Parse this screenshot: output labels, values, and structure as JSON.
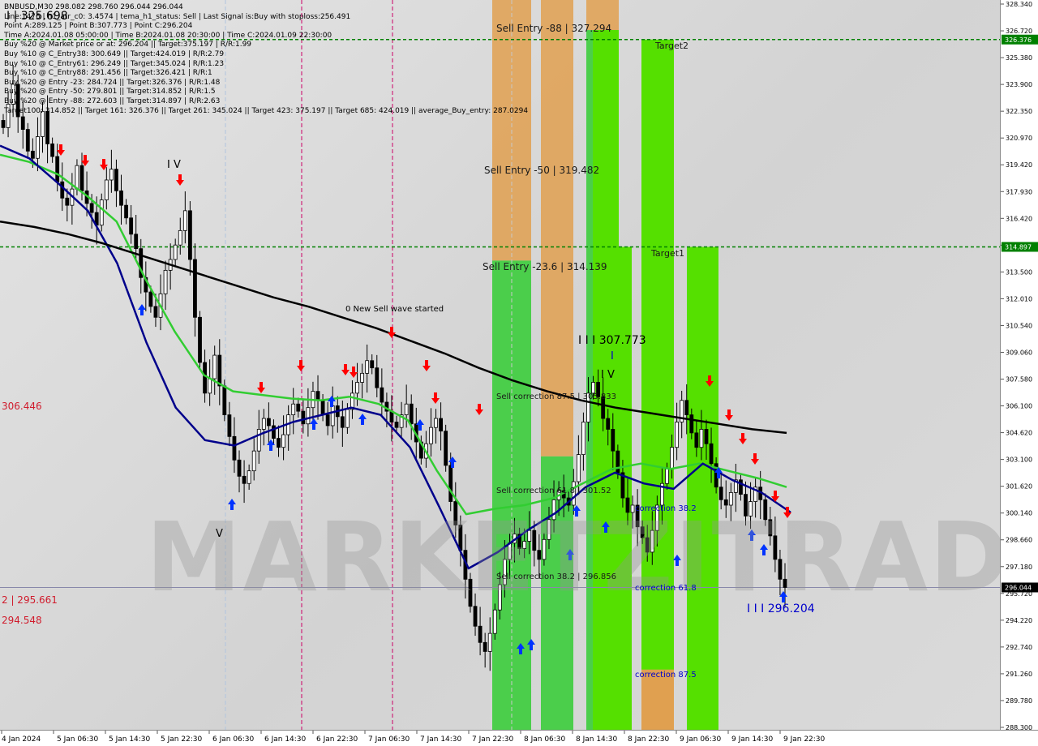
{
  "info_lines": [
    "BNBUSD,M30  298.082 298.760 296.044 296.044",
    "Line:1476 | h1_atr_c0: 3.4574 | tema_h1_status: Sell | Last Signal is:Buy with stoploss:256.491",
    "Point A:289.125 | Point B:307.773 | Point C:296.204",
    "Time A:2024.01.08 05:00:00 | Time B:2024.01.08 20:30:00 | Time C:2024.01.09 22:30:00",
    "Buy %20 @ Market price or at: 296.204 || Target:375.197 | R/R:1.99",
    "Buy %10 @ C_Entry38: 300.649 || Target:424.019 | R/R:2.79",
    "Buy %10 @ C_Entry61: 296.249 || Target:345.024 | R/R:1.23",
    "Buy %10 @ C_Entry88: 291.456 || Target:326.421 | R/R:1",
    "Buy %20 @ Entry -23: 284.724 || Target:326.376 | R/R:1.48",
    "Buy %20 @ Entry -50: 279.801 || Target:314.852 | R/R:1.5",
    "Buy %20 @ Entry -88: 272.603 || Target:314.897 | R/R:2.63",
    "Target100: 314.852 || Target 161: 326.376 || Target 261: 345.024 || Target 423: 375.197 || Target 685: 424.019 || average_Buy_entry: 287.0294"
  ],
  "chart_title": "BNBUSD,M30",
  "watermark": "MARKETZITRADE",
  "labels": {
    "wave_high": "I | 325.698",
    "wave_iv_top": "I V",
    "wave_v_bottom": "V",
    "new_sell_wave": "0 New Sell wave started",
    "point_b": "I I I 307.773",
    "point_b_tick": "I",
    "wave_iv_right": "I V",
    "point_c": "I I I 296.204",
    "sell_entry_88": "Sell Entry -88 | 327.294",
    "sell_entry_50": "Sell Entry -50 | 319.482",
    "sell_entry_23": "Sell Entry -23.6 | 314.139",
    "sell_corr_875": "Sell correction 87.5 | 305.833",
    "sell_corr_618": "Sell correction 61.8 | 301.52",
    "sell_corr_382": "Sell correction 38.2 | 296.856",
    "target2": "Target2",
    "target1": "Target1",
    "correction_382": "correction 38.2",
    "correction_618": "correction 61.8",
    "correction_875": "correction 87.5",
    "red_top": "306.446",
    "red_mid": "2 | 295.661",
    "red_low": "294.548"
  },
  "colors": {
    "background": "#dcdcdc",
    "zone_orange": "#e0a050",
    "zone_green": "#32cd32",
    "target_green": "#55e000",
    "ma_black": "#000000",
    "ma_navy": "#00008b",
    "ma_green": "#32cd32",
    "arrow_up": "#0033ff",
    "arrow_down": "#ff0000",
    "level_line": "#008000",
    "vline_red": "#cc0066",
    "label_red": "#d01b2c",
    "label_blue": "#0000cc"
  },
  "chart_data": {
    "type": "candlestick",
    "symbol": "BNBUSD",
    "timeframe": "M30",
    "ohlc_last": {
      "open": 298.082,
      "high": 298.76,
      "low": 296.044,
      "close": 296.044
    },
    "ylim": [
      288.3,
      328.34
    ],
    "y_ticks": [
      "328.340",
      "326.720",
      "325.380",
      "323.900",
      "322.350",
      "320.970",
      "319.420",
      "317.930",
      "316.420",
      "314.897",
      "313.500",
      "312.010",
      "310.540",
      "309.060",
      "307.580",
      "306.100",
      "304.620",
      "303.100",
      "301.620",
      "300.140",
      "298.660",
      "297.180",
      "295.720",
      "294.220",
      "292.740",
      "291.260",
      "289.780",
      "288.300"
    ],
    "x_ticks": [
      "4 Jan 2024",
      "5 Jan 06:30",
      "5 Jan 14:30",
      "5 Jan 22:30",
      "6 Jan 06:30",
      "6 Jan 14:30",
      "6 Jan 22:30",
      "7 Jan 06:30",
      "7 Jan 14:30",
      "7 Jan 22:30",
      "8 Jan 06:30",
      "8 Jan 14:30",
      "8 Jan 22:30",
      "9 Jan 06:30",
      "9 Jan 14:30",
      "9 Jan 22:30"
    ],
    "current_price": 296.044,
    "current_price_label": "296.044",
    "levels": [
      {
        "name": "target_161",
        "value": 326.376,
        "label": "326.376"
      },
      {
        "name": "target_100",
        "value": 314.897,
        "label": "314.897"
      }
    ],
    "close_series": [
      321.5,
      322.8,
      323.9,
      322.1,
      321.4,
      320.2,
      319.8,
      321.0,
      322.4,
      320.6,
      319.9,
      318.5,
      317.6,
      317.2,
      318.1,
      319.4,
      318.0,
      317.3,
      316.8,
      316.1,
      317.5,
      318.6,
      319.2,
      318.0,
      317.2,
      316.5,
      315.6,
      314.8,
      313.2,
      312.4,
      311.6,
      311.0,
      312.3,
      313.6,
      314.2,
      315.0,
      315.8,
      316.9,
      314.2,
      311.0,
      308.5,
      306.8,
      307.6,
      308.9,
      307.2,
      305.6,
      304.4,
      303.1,
      302.2,
      301.8,
      302.5,
      303.6,
      304.8,
      305.4,
      305.0,
      304.3,
      303.8,
      304.5,
      305.6,
      306.2,
      305.8,
      305.1,
      306.0,
      306.9,
      306.4,
      305.6,
      305.0,
      306.1,
      305.5,
      304.9,
      305.9,
      306.8,
      307.4,
      307.9,
      308.6,
      308.2,
      307.1,
      306.3,
      305.8,
      305.2,
      304.9,
      305.6,
      306.2,
      305.1,
      304.1,
      303.2,
      304.0,
      304.9,
      305.4,
      304.7,
      302.8,
      300.8,
      299.5,
      298.1,
      296.5,
      295.0,
      293.9,
      293.0,
      292.5,
      293.5,
      294.8,
      296.2,
      297.6,
      298.5,
      299.0,
      298.2,
      298.6,
      299.2,
      298.1,
      297.6,
      298.7,
      299.8,
      300.9,
      301.4,
      301.0,
      300.6,
      301.9,
      303.4,
      305.2,
      306.8,
      307.4,
      306.6,
      305.4,
      304.8,
      303.6,
      302.4,
      301.0,
      300.2,
      300.6,
      299.4,
      298.8,
      298.0,
      299.2,
      300.6,
      301.8,
      302.6,
      303.8,
      305.2,
      306.4,
      305.6,
      304.6,
      303.8,
      304.8,
      304.0,
      302.9,
      301.6,
      300.9,
      300.6,
      301.3,
      302.0,
      301.2,
      300.0,
      300.8,
      301.6,
      300.9,
      299.8,
      298.9,
      297.6,
      296.5,
      296.044
    ],
    "ma_black": [
      316.3,
      316.0,
      315.6,
      315.1,
      314.5,
      313.9,
      313.3,
      312.7,
      312.1,
      311.6,
      311.0,
      310.4,
      309.7,
      309.0,
      308.2,
      307.5,
      306.9,
      306.4,
      306.0,
      305.7,
      305.4,
      305.1,
      304.8,
      304.6
    ],
    "ma_navy": [
      320.5,
      319.8,
      318.4,
      316.9,
      314.0,
      309.6,
      306.0,
      304.2,
      303.9,
      304.6,
      305.2,
      305.6,
      306.0,
      305.6,
      303.8,
      300.5,
      297.1,
      298.0,
      299.2,
      300.2,
      301.6,
      302.4,
      301.8,
      301.5,
      302.9,
      302.0,
      301.3,
      300.2
    ],
    "ma_green": [
      320.0,
      319.6,
      318.9,
      317.7,
      316.3,
      313.1,
      310.2,
      307.8,
      306.9,
      306.7,
      306.5,
      306.4,
      306.6,
      306.2,
      305.3,
      302.5,
      300.1,
      300.4,
      300.6,
      301.0,
      301.8,
      302.6,
      302.9,
      302.6,
      302.9,
      302.5,
      302.1,
      301.6
    ],
    "zones": [
      {
        "type": "orange",
        "from": 314.139,
        "to": 328.34
      },
      {
        "type": "green",
        "from": 288.3,
        "to": 314.139
      },
      {
        "type": "target",
        "label": "Target2",
        "from": 288.3,
        "to": 326.376
      },
      {
        "type": "target",
        "label": "Target1",
        "from": 288.3,
        "to": 314.897
      }
    ]
  }
}
